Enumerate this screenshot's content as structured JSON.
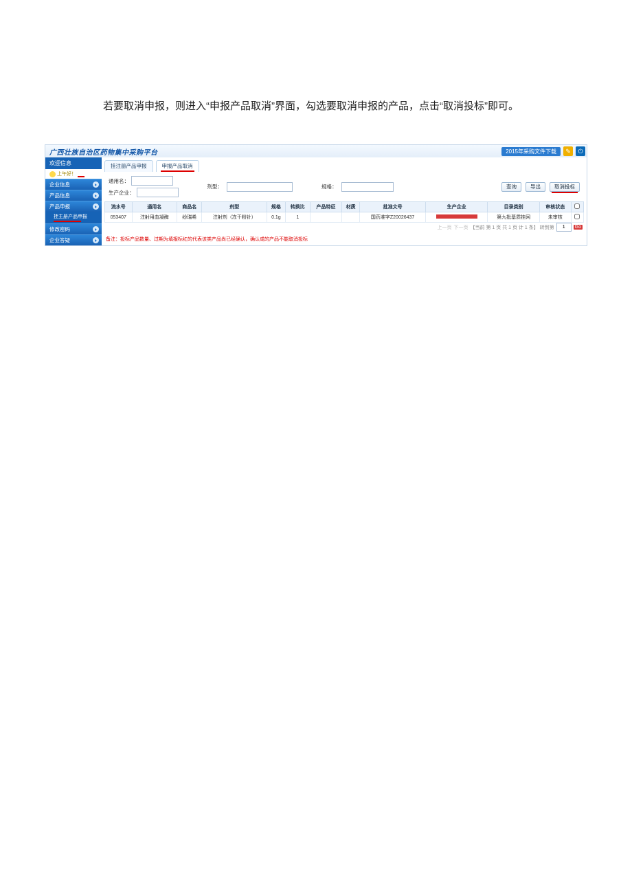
{
  "doc": {
    "paragraph": "若要取消申报，则进入“申报产品取消”界面，勾选要取消申报的产品，点击“取消投标”即可。"
  },
  "header": {
    "title": "广西壮族自治区药物集中采购平台",
    "download": "2015年采购文件下载"
  },
  "sidebar": {
    "welcome_head": "欢迎信息",
    "greeting": "上午好！",
    "items": [
      "企业信息",
      "产品信息",
      "产品申报",
      "修改密码",
      "企业答疑"
    ],
    "sub_apply": "挂主册产品申报"
  },
  "tabs": {
    "registered": "挂注册产品申报",
    "cancel": "申报产品取消"
  },
  "filters": {
    "common_name_lbl": "通用名：",
    "dosage_lbl": "剂型：",
    "spec_lbl": "规格：",
    "producer_lbl": "生产企业：",
    "query": "查询",
    "export": "导出",
    "cancel_bid": "取消投标"
  },
  "table": {
    "headers": [
      "流水号",
      "通用名",
      "商品名",
      "剂型",
      "规格",
      "转换比",
      "产品特征",
      "材质",
      "批准文号",
      "生产企业",
      "目录类别",
      "审核状态",
      ""
    ],
    "row": {
      "serial": "053407",
      "common_name": "注射用血凝酶",
      "trade_name": "纷瑞希",
      "dosage": "注射剂（冻干粉针）",
      "spec": "0.1g",
      "ratio": "1",
      "feature": "",
      "material": "",
      "approval": "国药准字Z20026437",
      "catalog": "第九批基质挂网",
      "status": "未审核"
    }
  },
  "note": "备注：投标产品数量、过期为填报标红的代表该类产品尚已经确认，确认成的产品不能取消投标",
  "pager": {
    "prev": "上一页",
    "next": "下一页",
    "info": "【当前 第 1 页   共 1 页   计 1 条】 转到第",
    "page_val": "1",
    "go": "Go"
  }
}
